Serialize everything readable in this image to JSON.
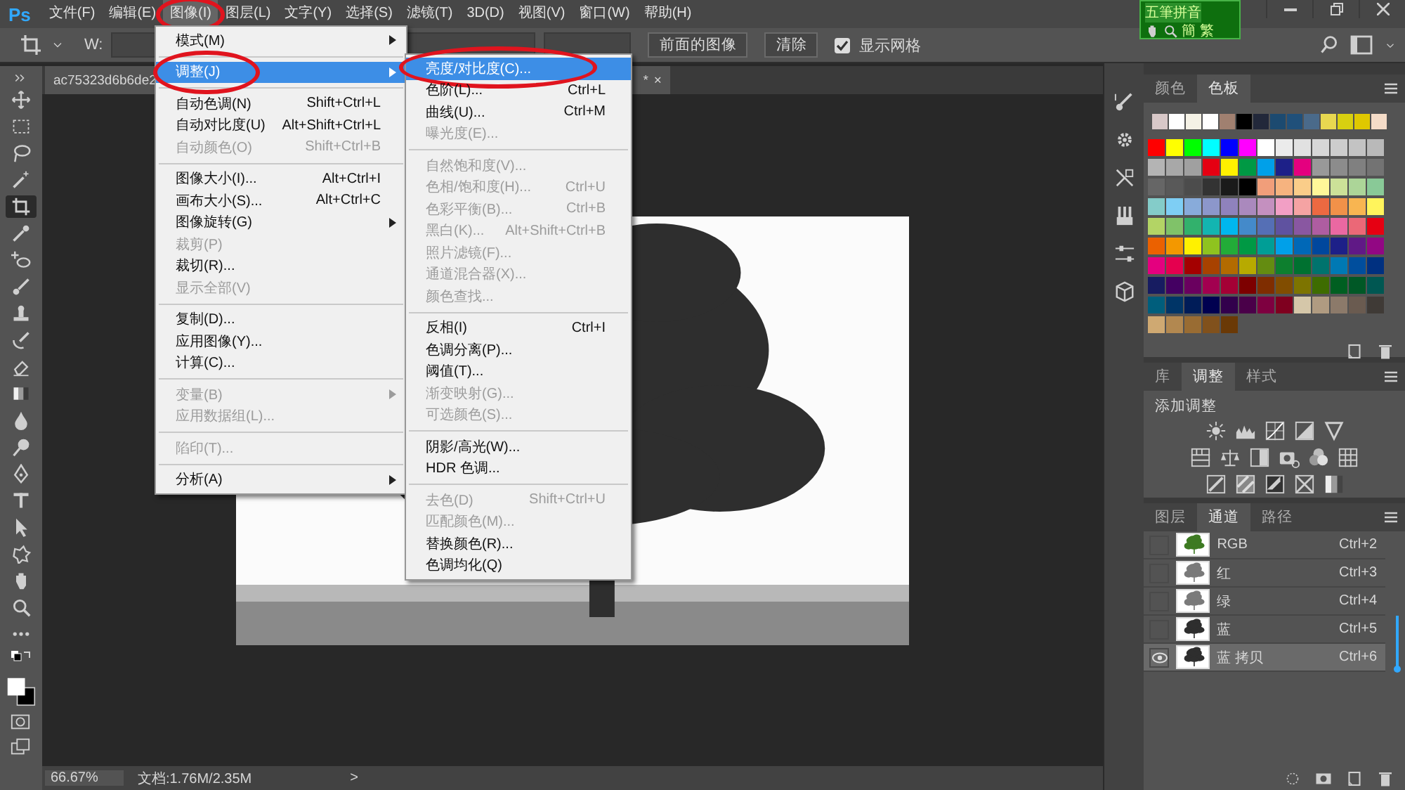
{
  "app": {
    "logo": "Ps"
  },
  "menubar": [
    {
      "label": "文件(F)",
      "selected": false
    },
    {
      "label": "编辑(E)",
      "selected": false
    },
    {
      "label": "图像(I)",
      "selected": true
    },
    {
      "label": "图层(L)",
      "selected": false
    },
    {
      "label": "文字(Y)",
      "selected": false
    },
    {
      "label": "选择(S)",
      "selected": false
    },
    {
      "label": "滤镜(T)",
      "selected": false
    },
    {
      "label": "3D(D)",
      "selected": false
    },
    {
      "label": "视图(V)",
      "selected": false
    },
    {
      "label": "窗口(W)",
      "selected": false
    },
    {
      "label": "帮助(H)",
      "selected": false
    }
  ],
  "ime": {
    "name": "五筆拼音",
    "modes": [
      "簡",
      "繁"
    ]
  },
  "options_bar": {
    "width_label": "W:",
    "buttons": [
      "前面的图像",
      "清除"
    ],
    "grid_checkbox": {
      "label": "显示网格",
      "checked": true
    }
  },
  "document_tab": {
    "title": "ac75323d6b6de2",
    "modified": "*",
    "close": "×"
  },
  "tools": [
    {
      "kind": "move",
      "selected": false
    },
    {
      "kind": "marquee",
      "selected": false
    },
    {
      "kind": "lasso",
      "selected": false
    },
    {
      "kind": "wand",
      "selected": false
    },
    {
      "kind": "crop",
      "selected": true
    },
    {
      "kind": "eyedropper",
      "selected": false
    },
    {
      "kind": "heal",
      "selected": false
    },
    {
      "kind": "brush",
      "selected": false
    },
    {
      "kind": "stamp",
      "selected": false
    },
    {
      "kind": "history",
      "selected": false
    },
    {
      "kind": "eraser",
      "selected": false
    },
    {
      "kind": "gradient",
      "selected": false
    },
    {
      "kind": "blur",
      "selected": false
    },
    {
      "kind": "dodge",
      "selected": false
    },
    {
      "kind": "pen",
      "selected": false
    },
    {
      "kind": "type",
      "selected": false
    },
    {
      "kind": "select",
      "selected": false
    },
    {
      "kind": "shape",
      "selected": false
    },
    {
      "kind": "hand",
      "selected": false
    },
    {
      "kind": "zoom",
      "selected": false
    },
    {
      "kind": "more",
      "selected": false
    }
  ],
  "image_menu": {
    "groups": [
      [
        {
          "label": "模式(M)",
          "disabled": false,
          "submenu": true,
          "selected": false
        }
      ],
      [
        {
          "label": "调整(J)",
          "disabled": false,
          "submenu": true,
          "selected": true
        }
      ],
      [
        {
          "label": "自动色调(N)",
          "shortcut": "Shift+Ctrl+L",
          "disabled": false,
          "submenu": false,
          "selected": false
        },
        {
          "label": "自动对比度(U)",
          "shortcut": "Alt+Shift+Ctrl+L",
          "disabled": false,
          "submenu": false,
          "selected": false
        },
        {
          "label": "自动颜色(O)",
          "shortcut": "Shift+Ctrl+B",
          "disabled": true,
          "submenu": false,
          "selected": false
        }
      ],
      [
        {
          "label": "图像大小(I)...",
          "shortcut": "Alt+Ctrl+I",
          "disabled": false,
          "submenu": false,
          "selected": false
        },
        {
          "label": "画布大小(S)...",
          "shortcut": "Alt+Ctrl+C",
          "disabled": false,
          "submenu": false,
          "selected": false
        },
        {
          "label": "图像旋转(G)",
          "disabled": false,
          "submenu": true,
          "selected": false
        },
        {
          "label": "裁剪(P)",
          "disabled": true,
          "submenu": false,
          "selected": false
        },
        {
          "label": "裁切(R)...",
          "disabled": false,
          "submenu": false,
          "selected": false
        },
        {
          "label": "显示全部(V)",
          "disabled": true,
          "submenu": false,
          "selected": false
        }
      ],
      [
        {
          "label": "复制(D)...",
          "disabled": false,
          "submenu": false,
          "selected": false
        },
        {
          "label": "应用图像(Y)...",
          "disabled": false,
          "submenu": false,
          "selected": false
        },
        {
          "label": "计算(C)...",
          "disabled": false,
          "submenu": false,
          "selected": false
        }
      ],
      [
        {
          "label": "变量(B)",
          "disabled": true,
          "submenu": true,
          "selected": false
        },
        {
          "label": "应用数据组(L)...",
          "disabled": true,
          "submenu": false,
          "selected": false
        }
      ],
      [
        {
          "label": "陷印(T)...",
          "disabled": true,
          "submenu": false,
          "selected": false
        }
      ],
      [
        {
          "label": "分析(A)",
          "disabled": false,
          "submenu": true,
          "selected": false
        }
      ]
    ]
  },
  "adjust_submenu": {
    "groups": [
      [
        {
          "label": "亮度/对比度(C)...",
          "disabled": false,
          "selected": true
        },
        {
          "label": "色阶(L)...",
          "shortcut": "Ctrl+L",
          "disabled": false,
          "selected": false
        },
        {
          "label": "曲线(U)...",
          "shortcut": "Ctrl+M",
          "disabled": false,
          "selected": false
        },
        {
          "label": "曝光度(E)...",
          "disabled": true,
          "selected": false
        }
      ],
      [
        {
          "label": "自然饱和度(V)...",
          "disabled": true,
          "selected": false
        },
        {
          "label": "色相/饱和度(H)...",
          "shortcut": "Ctrl+U",
          "disabled": true,
          "selected": false
        },
        {
          "label": "色彩平衡(B)...",
          "shortcut": "Ctrl+B",
          "disabled": true,
          "selected": false
        },
        {
          "label": "黑白(K)...",
          "shortcut": "Alt+Shift+Ctrl+B",
          "disabled": true,
          "selected": false
        },
        {
          "label": "照片滤镜(F)...",
          "disabled": true,
          "selected": false
        },
        {
          "label": "通道混合器(X)...",
          "disabled": true,
          "selected": false
        },
        {
          "label": "颜色查找...",
          "disabled": true,
          "selected": false
        }
      ],
      [
        {
          "label": "反相(I)",
          "shortcut": "Ctrl+I",
          "disabled": false,
          "selected": false
        },
        {
          "label": "色调分离(P)...",
          "disabled": false,
          "selected": false
        },
        {
          "label": "阈值(T)...",
          "disabled": false,
          "selected": false
        },
        {
          "label": "渐变映射(G)...",
          "disabled": true,
          "selected": false
        },
        {
          "label": "可选颜色(S)...",
          "disabled": true,
          "selected": false
        }
      ],
      [
        {
          "label": "阴影/高光(W)...",
          "disabled": false,
          "selected": false
        },
        {
          "label": "HDR 色调...",
          "disabled": false,
          "selected": false
        }
      ],
      [
        {
          "label": "去色(D)",
          "shortcut": "Shift+Ctrl+U",
          "disabled": true,
          "selected": false
        },
        {
          "label": "匹配颜色(M)...",
          "disabled": true,
          "selected": false
        },
        {
          "label": "替换颜色(R)...",
          "disabled": false,
          "selected": false
        },
        {
          "label": "色调均化(Q)",
          "disabled": false,
          "selected": false
        }
      ]
    ]
  },
  "status_bar": {
    "zoom": "66.67%",
    "doc": "文档:1.76M/2.35M",
    "arrow": ">"
  },
  "swatches_panel": {
    "tabs": [
      {
        "label": "颜色",
        "selected": false
      },
      {
        "label": "色板",
        "selected": true
      }
    ],
    "recent": [
      {
        "color": "#d8c8c8"
      },
      {
        "color": "#ffffff"
      },
      {
        "color": "#f5f2e6"
      },
      {
        "color": "#ffffff"
      },
      {
        "color": "#a08070"
      },
      {
        "color": "#000000"
      },
      {
        "color": "#22283a"
      },
      {
        "color": "#1c4a70"
      },
      {
        "color": "#20507a"
      },
      {
        "color": "#4a6a8a"
      },
      {
        "color": "#e8d850"
      },
      {
        "color": "#d8d010"
      },
      {
        "color": "#e0c800"
      },
      {
        "color": "#f5dcc8"
      }
    ],
    "grid": [
      {
        "color": "#ff0000"
      },
      {
        "color": "#ffff00"
      },
      {
        "color": "#00ff00"
      },
      {
        "color": "#00ffff"
      },
      {
        "color": "#0000ff"
      },
      {
        "color": "#ff00ff"
      },
      {
        "color": "#ffffff"
      },
      {
        "color": "#ebebeb"
      },
      {
        "color": "#e1e1e1"
      },
      {
        "color": "#d7d7d7"
      },
      {
        "color": "#cdcdcd"
      },
      {
        "color": "#c3c3c3"
      },
      {
        "color": "#b9b9b9"
      },
      {
        "color": "#b4b4b4"
      },
      {
        "color": "#a8a8a8"
      },
      {
        "color": "#a0a0a0"
      },
      {
        "color": "#e50012"
      },
      {
        "color": "#fff000"
      },
      {
        "color": "#009944"
      },
      {
        "color": "#00a0e9"
      },
      {
        "color": "#1d2088"
      },
      {
        "color": "#e4007f"
      },
      {
        "color": "#999999"
      },
      {
        "color": "#8c8c8c"
      },
      {
        "color": "#808080"
      },
      {
        "color": "#737373"
      },
      {
        "color": "#666666"
      },
      {
        "color": "#595959"
      },
      {
        "color": "#4c4c4c"
      },
      {
        "color": "#333333"
      },
      {
        "color": "#1a1a1a"
      },
      {
        "color": "#000000"
      },
      {
        "color": "#f19e7a"
      },
      {
        "color": "#f6b37f"
      },
      {
        "color": "#facd89"
      },
      {
        "color": "#fff799"
      },
      {
        "color": "#cce198"
      },
      {
        "color": "#acd598"
      },
      {
        "color": "#89c997"
      },
      {
        "color": "#84ccc9"
      },
      {
        "color": "#7ecef4"
      },
      {
        "color": "#88abda"
      },
      {
        "color": "#8c97cb"
      },
      {
        "color": "#8f82bc"
      },
      {
        "color": "#aa89bd"
      },
      {
        "color": "#c490bf"
      },
      {
        "color": "#f29fc5"
      },
      {
        "color": "#f5a3a3"
      },
      {
        "color": "#ec6941"
      },
      {
        "color": "#f19149"
      },
      {
        "color": "#f8b551"
      },
      {
        "color": "#fff45c"
      },
      {
        "color": "#b3d465"
      },
      {
        "color": "#80c269"
      },
      {
        "color": "#32b16c"
      },
      {
        "color": "#13b5b1"
      },
      {
        "color": "#00b7ee"
      },
      {
        "color": "#448aca"
      },
      {
        "color": "#556fb5"
      },
      {
        "color": "#5f52a0"
      },
      {
        "color": "#8957a1"
      },
      {
        "color": "#ae5da1"
      },
      {
        "color": "#ea68a2"
      },
      {
        "color": "#eb6877"
      },
      {
        "color": "#e60012"
      },
      {
        "color": "#eb6100"
      },
      {
        "color": "#f39800"
      },
      {
        "color": "#fff100"
      },
      {
        "color": "#8fc31f"
      },
      {
        "color": "#22ac38"
      },
      {
        "color": "#009944"
      },
      {
        "color": "#009e96"
      },
      {
        "color": "#00a0e9"
      },
      {
        "color": "#0068b7"
      },
      {
        "color": "#00479d"
      },
      {
        "color": "#1d2088"
      },
      {
        "color": "#601986"
      },
      {
        "color": "#920783"
      },
      {
        "color": "#e4007f"
      },
      {
        "color": "#e5004f"
      },
      {
        "color": "#a40000"
      },
      {
        "color": "#a84200"
      },
      {
        "color": "#b36b00"
      },
      {
        "color": "#b7aa00"
      },
      {
        "color": "#648c11"
      },
      {
        "color": "#0d7f2e"
      },
      {
        "color": "#007130"
      },
      {
        "color": "#00736d"
      },
      {
        "color": "#0079b4"
      },
      {
        "color": "#004e9d"
      },
      {
        "color": "#003080"
      },
      {
        "color": "#171c61"
      },
      {
        "color": "#440062"
      },
      {
        "color": "#6a005f"
      },
      {
        "color": "#a20050"
      },
      {
        "color": "#a40035"
      },
      {
        "color": "#7d0000"
      },
      {
        "color": "#7f2d00"
      },
      {
        "color": "#814d00"
      },
      {
        "color": "#7d7400"
      },
      {
        "color": "#3e6c00"
      },
      {
        "color": "#005f21"
      },
      {
        "color": "#005826"
      },
      {
        "color": "#005752"
      },
      {
        "color": "#005e7c"
      },
      {
        "color": "#003567"
      },
      {
        "color": "#001c58"
      },
      {
        "color": "#000050"
      },
      {
        "color": "#32004c"
      },
      {
        "color": "#4a0049"
      },
      {
        "color": "#7e0040"
      },
      {
        "color": "#7f001f"
      },
      {
        "color": "#d5c7a9"
      },
      {
        "color": "#b09b81"
      },
      {
        "color": "#8c7a6a"
      },
      {
        "color": "#6a5b50"
      },
      {
        "color": "#3f3a36"
      },
      {
        "color": "#cfa972"
      },
      {
        "color": "#b28850"
      },
      {
        "color": "#996c33"
      },
      {
        "color": "#81511c"
      },
      {
        "color": "#6a3906"
      }
    ]
  },
  "adjustments_panel": {
    "tabs": [
      {
        "label": "库",
        "selected": false
      },
      {
        "label": "调整",
        "selected": true
      },
      {
        "label": "样式",
        "selected": false
      }
    ],
    "heading": "添加调整"
  },
  "channels_panel": {
    "tabs": [
      {
        "label": "图层",
        "selected": false
      },
      {
        "label": "通道",
        "selected": true
      },
      {
        "label": "路径",
        "selected": false
      }
    ],
    "channels": [
      {
        "name": "RGB",
        "shortcut": "Ctrl+2",
        "visible": false,
        "selected": false,
        "kind": "color"
      },
      {
        "name": "红",
        "shortcut": "Ctrl+3",
        "visible": false,
        "selected": false,
        "kind": "gray"
      },
      {
        "name": "绿",
        "shortcut": "Ctrl+4",
        "visible": false,
        "selected": false,
        "kind": "gray"
      },
      {
        "name": "蓝",
        "shortcut": "Ctrl+5",
        "visible": false,
        "selected": false,
        "kind": "dark"
      },
      {
        "name": "蓝 拷贝",
        "shortcut": "Ctrl+6",
        "visible": true,
        "selected": true,
        "kind": "dark"
      }
    ]
  }
}
